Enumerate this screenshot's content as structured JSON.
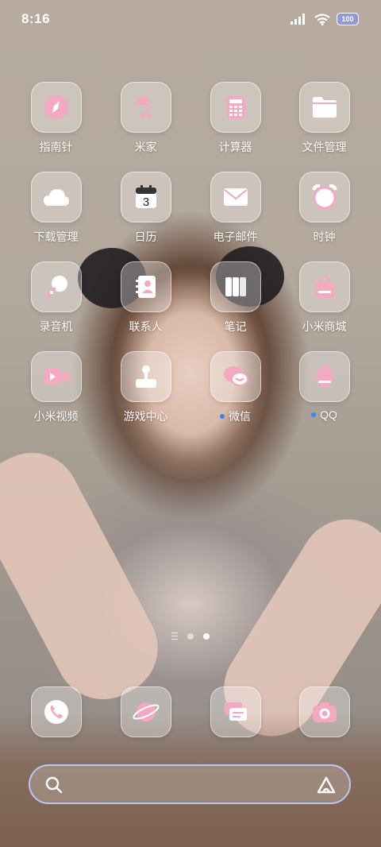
{
  "status": {
    "time": "8:16",
    "battery": "100"
  },
  "apps": [
    {
      "label": "指南针",
      "icon": "compass-icon",
      "dot": false
    },
    {
      "label": "米家",
      "icon": "mijia-lamp-icon",
      "dot": false
    },
    {
      "label": "计算器",
      "icon": "calculator-icon",
      "dot": false
    },
    {
      "label": "文件管理",
      "icon": "folder-icon",
      "dot": false
    },
    {
      "label": "下载管理",
      "icon": "cloud-icon",
      "dot": false
    },
    {
      "label": "日历",
      "icon": "calendar-icon",
      "dot": false,
      "day": "3"
    },
    {
      "label": "电子邮件",
      "icon": "mail-icon",
      "dot": false
    },
    {
      "label": "时钟",
      "icon": "alarm-clock-icon",
      "dot": false
    },
    {
      "label": "录音机",
      "icon": "microphone-icon",
      "dot": false
    },
    {
      "label": "联系人",
      "icon": "contacts-book-icon",
      "dot": false
    },
    {
      "label": "笔记",
      "icon": "notes-icon",
      "dot": false
    },
    {
      "label": "小米商城",
      "icon": "shopping-bag-icon",
      "dot": false
    },
    {
      "label": "小米视频",
      "icon": "video-icon",
      "dot": false
    },
    {
      "label": "游戏中心",
      "icon": "joystick-icon",
      "dot": false
    },
    {
      "label": "微信",
      "icon": "wechat-icon",
      "dot": true
    },
    {
      "label": "QQ",
      "icon": "qq-penguin-icon",
      "dot": true
    }
  ],
  "dock": [
    {
      "icon": "phone-icon"
    },
    {
      "icon": "browser-planet-icon"
    },
    {
      "icon": "messages-icon"
    },
    {
      "icon": "camera-icon"
    }
  ],
  "colors": {
    "icon_pink": "#f3a9c0",
    "dot_blue": "#3b82f6"
  }
}
